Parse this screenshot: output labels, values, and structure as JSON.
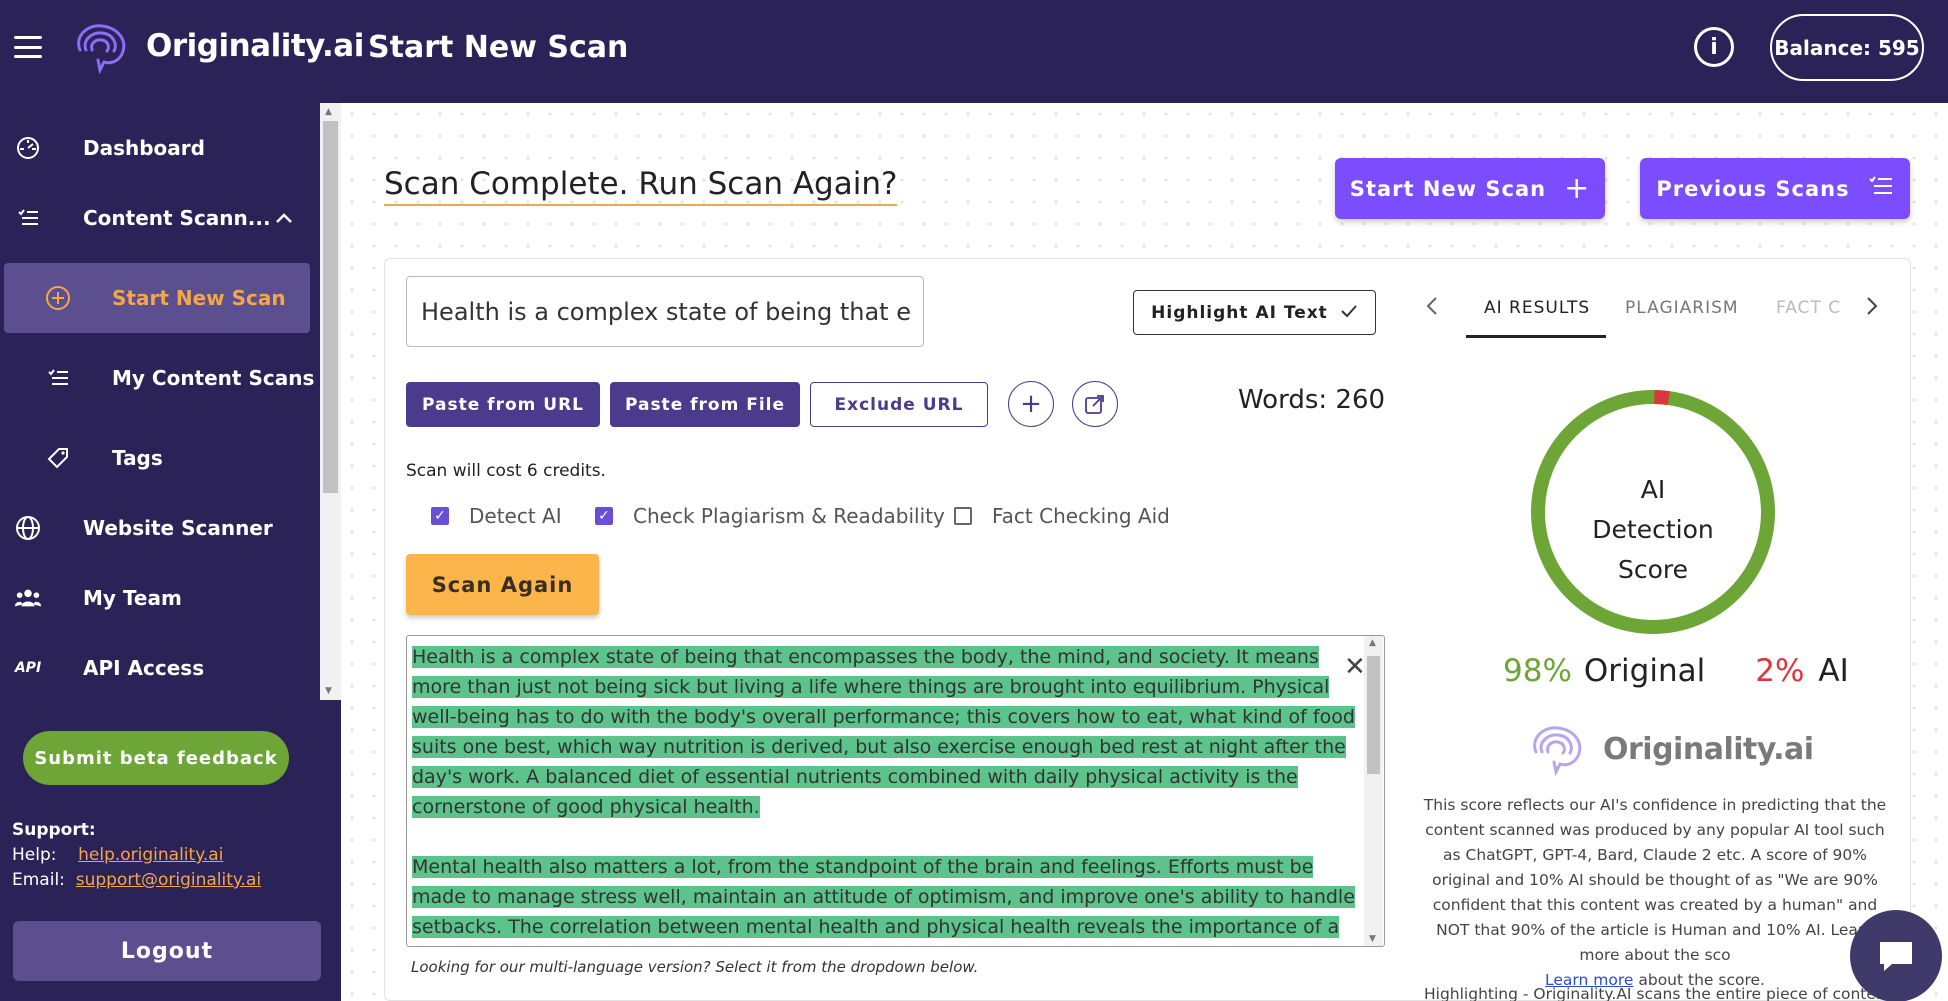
{
  "header": {
    "brand": "Originality.ai",
    "page_title": "Start New Scan",
    "balance": "Balance: 595"
  },
  "sidebar": {
    "items": [
      {
        "label": "Dashboard",
        "icon": "dashboard-icon"
      },
      {
        "label": "Content Scann...",
        "icon": "list-check-icon"
      },
      {
        "label": "Start New Scan",
        "icon": "plus-circle-icon"
      },
      {
        "label": "My Content Scans",
        "icon": "list-check-icon"
      },
      {
        "label": "Tags",
        "icon": "tag-icon"
      },
      {
        "label": "Website Scanner",
        "icon": "globe-icon"
      },
      {
        "label": "My Team",
        "icon": "users-icon"
      },
      {
        "label": "API Access",
        "icon": "api-icon"
      }
    ],
    "beta_feedback": "Submit beta feedback",
    "support_label": "Support:",
    "help_label": "Help:",
    "help_link": "help.originality.ai",
    "email_label": "Email:",
    "email_link": "support@originality.ai",
    "logout": "Logout"
  },
  "main": {
    "scan_title": "Scan Complete. Run Scan Again?",
    "start_new_scan": "Start New Scan",
    "previous_scans": "Previous Scans",
    "title_input_value": "Health is a complex state of being that e",
    "highlight_ai_text": "Highlight AI Text",
    "paste_from_url": "Paste from URL",
    "paste_from_file": "Paste from File",
    "exclude_url": "Exclude URL",
    "words": "Words: 260",
    "cost": "Scan will cost 6 credits.",
    "options": [
      {
        "label": "Detect AI",
        "checked": true
      },
      {
        "label": "Check Plagiarism & Readability",
        "checked": true
      },
      {
        "label": "Fact Checking Aid",
        "checked": false
      }
    ],
    "scan_again": "Scan Again",
    "content_p1": "Health is a complex state of being that encompasses the body, the mind, and society. It means more than just not being sick but living a life where things are brought into equilibrium. Physical well-being has to do with the body's overall performance; this covers how to eat, what kind of food suits one best, which way nutrition is derived, but also exercise enough bed rest at night after the day's work. A balanced diet of essential nutrients combined with daily physical activity is the cornerstone of good physical health.",
    "content_p2": "Mental health also matters a lot, from the standpoint of the brain and feelings. Efforts must be made to manage stress well, maintain an attitude of optimism, and improve one's ability to handle setbacks. The correlation between mental health and physical health reveals the importance of a comprehensive approach to wellbeing.",
    "multi_lang_note": "Looking for our multi-language version? Select it from the dropdown below."
  },
  "results": {
    "tabs": [
      "AI RESULTS",
      "PLAGIARISM",
      "FACT C"
    ],
    "donut_label": "AI Detection Score",
    "original_pct": "98%",
    "original_label": "Original",
    "ai_pct": "2%",
    "ai_label": "AI",
    "original_fraction": 0.98,
    "brand": "Originality.ai",
    "explanation": "This score reflects our AI's confidence in predicting that the content scanned was produced by any popular AI tool such as ChatGPT, GPT-4, Bard, Claude 2 etc. A score of 90% original and 10% AI should be thought of as \"We are 90% confident that this content was created by a human\" and NOT that 90% of the article is Human and 10% AI. Learn more about the sco",
    "learn_more": "Learn more",
    "learn_more_suffix": " about the score.",
    "highlighting_note": "Highlighting - Originality.AI scans the entire piece of content as",
    "colors": {
      "original": "#6ea537",
      "ai": "#d9363e"
    }
  }
}
